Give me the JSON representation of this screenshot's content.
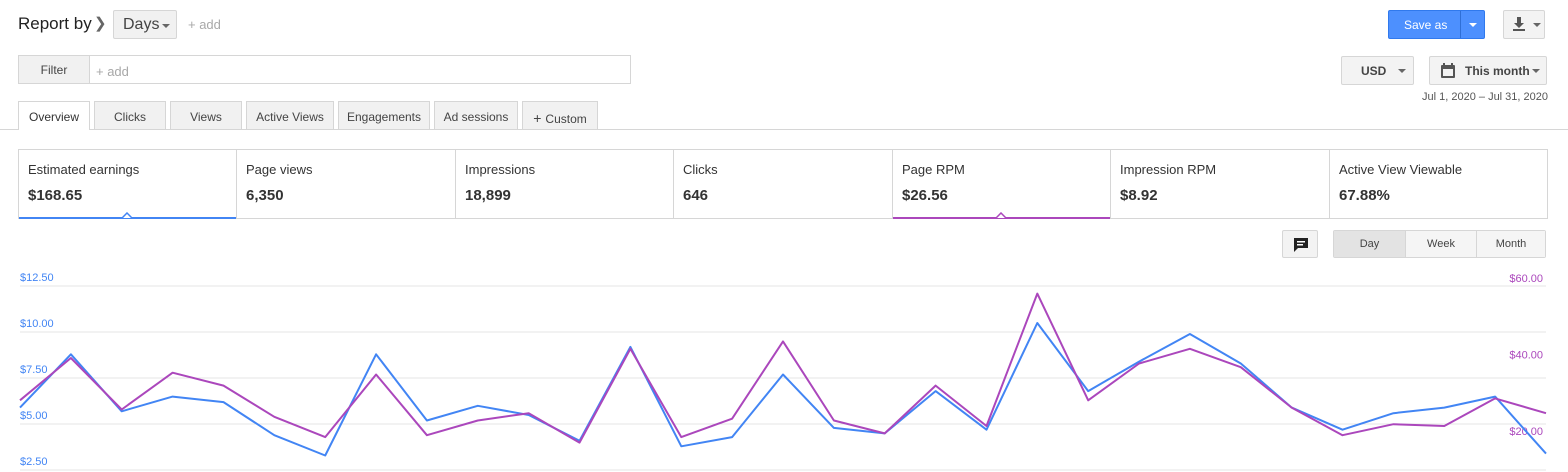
{
  "header": {
    "report_by": "Report by",
    "dimension": "Days",
    "add": "+ add",
    "save_as": "Save as"
  },
  "filter": {
    "label": "Filter",
    "placeholder": "+ add"
  },
  "currency": "USD",
  "date_range": {
    "label": "This month",
    "dates": "Jul 1, 2020 – Jul 31, 2020"
  },
  "tabs": [
    {
      "label": "Overview",
      "active": true
    },
    {
      "label": "Clicks"
    },
    {
      "label": "Views"
    },
    {
      "label": "Active Views"
    },
    {
      "label": "Engagements"
    },
    {
      "label": "Ad sessions"
    },
    {
      "label": "Custom"
    }
  ],
  "metrics": [
    {
      "label": "Estimated earnings",
      "value": "$168.65",
      "selected": true,
      "color": "#4285f4"
    },
    {
      "label": "Page views",
      "value": "6,350"
    },
    {
      "label": "Impressions",
      "value": "18,899"
    },
    {
      "label": "Clicks",
      "value": "646"
    },
    {
      "label": "Page RPM",
      "value": "$26.56",
      "selected": true,
      "color": "#ab47bc"
    },
    {
      "label": "Impression RPM",
      "value": "$8.92"
    },
    {
      "label": "Active View Viewable",
      "value": "67.88%"
    }
  ],
  "periods": [
    {
      "label": "Day",
      "active": true
    },
    {
      "label": "Week"
    },
    {
      "label": "Month"
    }
  ],
  "icons": {
    "download": "download-icon",
    "calendar": "calendar-icon",
    "annotation": "comment-icon"
  },
  "colors": {
    "primary_button": "#4d90fe",
    "earnings_series": "#4285f4",
    "rpm_series": "#ab47bc"
  },
  "chart_data": {
    "type": "line",
    "x": [
      1,
      2,
      3,
      4,
      5,
      6,
      7,
      8,
      9,
      10,
      11,
      12,
      13,
      14,
      15,
      16,
      17,
      18,
      19,
      20,
      21,
      22,
      23,
      24,
      25,
      26,
      27,
      28,
      29,
      30,
      31
    ],
    "left_axis": {
      "ticks": [
        "$12.50",
        "$10.00",
        "$7.50",
        "$5.00",
        "$2.50"
      ],
      "range": [
        2.5,
        12.5
      ]
    },
    "right_axis": {
      "ticks": [
        "$60.00",
        "$40.00",
        "$20.00"
      ],
      "range": [
        20,
        60
      ]
    },
    "series": [
      {
        "name": "Estimated earnings",
        "axis": "left",
        "color": "#4285f4",
        "values": [
          5.4,
          8.3,
          5.2,
          6.0,
          5.7,
          3.9,
          2.8,
          8.3,
          4.7,
          5.5,
          5.0,
          3.6,
          8.7,
          3.3,
          3.8,
          7.2,
          4.3,
          4.0,
          6.3,
          4.2,
          10.0,
          6.3,
          7.9,
          9.4,
          7.8,
          5.4,
          4.2,
          5.1,
          5.4,
          6.0,
          2.9
        ]
      },
      {
        "name": "Page RPM",
        "axis": "left",
        "color": "#ab47bc",
        "values": [
          5.8,
          8.1,
          5.3,
          7.3,
          6.6,
          4.9,
          3.8,
          7.2,
          3.9,
          4.7,
          5.1,
          3.5,
          8.6,
          3.8,
          4.8,
          9.0,
          4.7,
          4.0,
          6.6,
          4.4,
          11.6,
          5.8,
          7.8,
          8.6,
          7.6,
          5.4,
          3.9,
          4.5,
          4.4,
          5.9,
          5.1
        ]
      }
    ]
  }
}
